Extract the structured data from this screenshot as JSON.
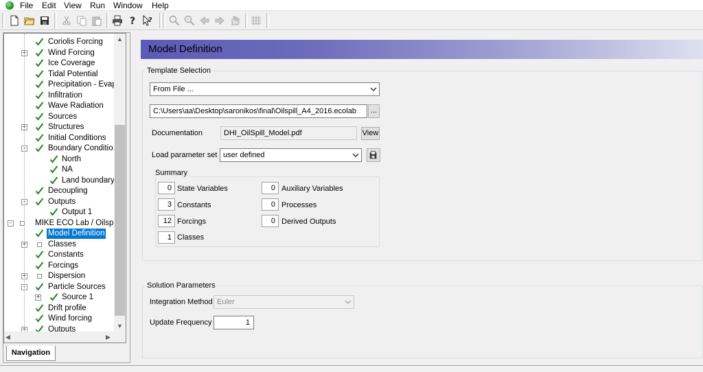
{
  "menu": [
    "File",
    "Edit",
    "View",
    "Run",
    "Window",
    "Help"
  ],
  "toolbar": {
    "icons": [
      "new-icon",
      "open-icon",
      "save-icon",
      "cut-icon",
      "copy-icon",
      "paste-icon",
      "print-icon",
      "help-icon",
      "context-help-icon",
      "zoom-in-icon",
      "zoom-out-icon",
      "back-icon",
      "forward-icon",
      "pan-icon",
      "grid-icon"
    ]
  },
  "tree": {
    "items": [
      {
        "label": "Coriolis Forcing",
        "level": 1,
        "check": true,
        "expander": ""
      },
      {
        "label": "Wind Forcing",
        "level": 1,
        "check": true,
        "expander": "+"
      },
      {
        "label": "Ice Coverage",
        "level": 1,
        "check": true,
        "expander": ""
      },
      {
        "label": "Tidal Potential",
        "level": 1,
        "check": true,
        "expander": ""
      },
      {
        "label": "Precipitation - Evapor",
        "level": 1,
        "check": true,
        "expander": ""
      },
      {
        "label": "Infiltration",
        "level": 1,
        "check": true,
        "expander": ""
      },
      {
        "label": "Wave Radiation",
        "level": 1,
        "check": true,
        "expander": ""
      },
      {
        "label": "Sources",
        "level": 1,
        "check": true,
        "expander": ""
      },
      {
        "label": "Structures",
        "level": 1,
        "check": true,
        "expander": "+"
      },
      {
        "label": "Initial Conditions",
        "level": 1,
        "check": true,
        "expander": ""
      },
      {
        "label": "Boundary Conditio...",
        "level": 1,
        "check": true,
        "expander": "-"
      },
      {
        "label": "North",
        "level": 2,
        "check": true,
        "expander": ""
      },
      {
        "label": "NA",
        "level": 2,
        "check": true,
        "expander": ""
      },
      {
        "label": "Land boundary",
        "level": 2,
        "check": true,
        "expander": ""
      },
      {
        "label": "Decoupling",
        "level": 1,
        "check": true,
        "expander": ""
      },
      {
        "label": "Outputs",
        "level": 1,
        "check": true,
        "expander": "-"
      },
      {
        "label": "Output 1",
        "level": 2,
        "check": true,
        "expander": ""
      },
      {
        "label": "MIKE ECO Lab / Oilspill M",
        "level": 0,
        "check": false,
        "square": true,
        "expander": "-"
      },
      {
        "label": "Model Definition",
        "level": 1,
        "check": true,
        "expander": "",
        "selected": true
      },
      {
        "label": "Classes",
        "level": 1,
        "check": false,
        "square": true,
        "expander": "+"
      },
      {
        "label": "Constants",
        "level": 1,
        "check": true,
        "expander": ""
      },
      {
        "label": "Forcings",
        "level": 1,
        "check": true,
        "expander": ""
      },
      {
        "label": "Dispersion",
        "level": 1,
        "check": false,
        "square": true,
        "expander": "+"
      },
      {
        "label": "Particle Sources",
        "level": 1,
        "check": true,
        "expander": "-"
      },
      {
        "label": "Source 1",
        "level": 2,
        "check": true,
        "expander": "+"
      },
      {
        "label": "Drift profile",
        "level": 1,
        "check": true,
        "expander": ""
      },
      {
        "label": "Wind forcing",
        "level": 1,
        "check": true,
        "expander": ""
      },
      {
        "label": "Outputs",
        "level": 1,
        "check": true,
        "expander": "+"
      }
    ]
  },
  "nav_tab": "Navigation",
  "main": {
    "title": "Model Definition",
    "template_selection": {
      "group_label": "Template Selection",
      "source_value": "From File ...",
      "file_path": "C:\\Users\\aa\\Desktop\\saronikos\\final\\Oilspill_A4_2016.ecolab",
      "browse_label": "...",
      "documentation_label": "Documentation",
      "documentation_value": "DHI_OilSpill_Model.pdf",
      "view_label": "View",
      "param_set_label": "Load parameter set",
      "param_set_value": "user defined"
    },
    "summary": {
      "group_label": "Summary",
      "left": [
        {
          "value": "0",
          "label": "State Variables"
        },
        {
          "value": "3",
          "label": "Constants"
        },
        {
          "value": "12",
          "label": "Forcings"
        },
        {
          "value": "1",
          "label": "Classes"
        }
      ],
      "right": [
        {
          "value": "0",
          "label": "Auxiliary Variables"
        },
        {
          "value": "0",
          "label": "Processes"
        },
        {
          "value": "0",
          "label": "Derived Outputs"
        }
      ]
    },
    "solution": {
      "group_label": "Solution Parameters",
      "integration_label": "Integration Method",
      "integration_value": "Euler",
      "update_label": "Update Frequency",
      "update_value": "1"
    }
  }
}
